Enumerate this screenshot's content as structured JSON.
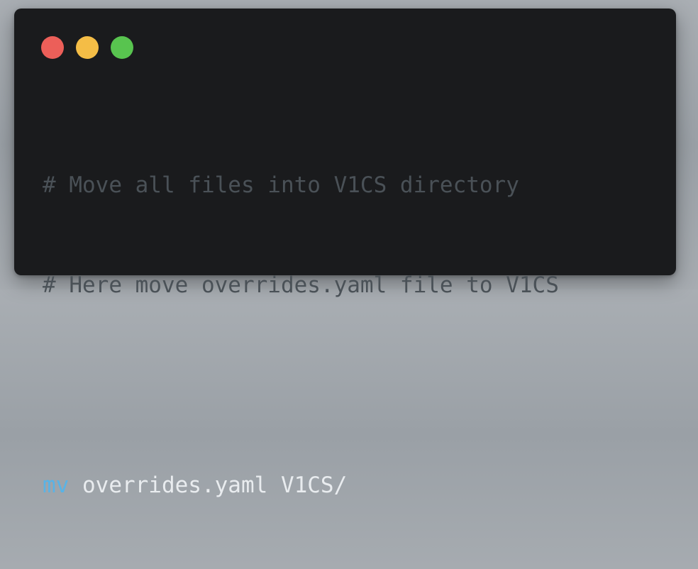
{
  "window": {
    "controls": [
      {
        "name": "close",
        "color": "#ec5f59"
      },
      {
        "name": "minimize",
        "color": "#f4bd46"
      },
      {
        "name": "maximize",
        "color": "#58c44f"
      }
    ]
  },
  "code": {
    "comment_1": "# Move all files into V1CS directory",
    "comment_2": "# Here move overrides.yaml file to V1CS",
    "command": "mv",
    "arguments": " overrides.yaml V1CS/"
  },
  "colors": {
    "comment": "#4a5157",
    "command": "#59b3e6",
    "text": "#e9ecef",
    "background": "#1a1b1d"
  }
}
